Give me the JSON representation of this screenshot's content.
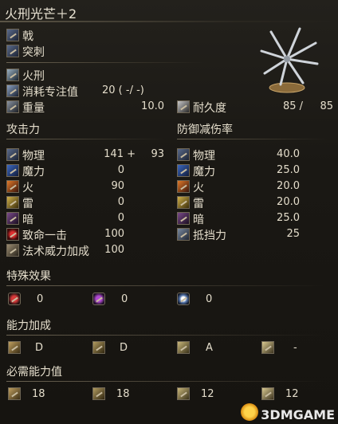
{
  "title": "火刑光芒＋2",
  "weapon_info": {
    "type": "戟",
    "attack_type": "突刺",
    "skill": "火刑",
    "fp_cost_label": "消耗专注值",
    "fp_cost_value": "20 (   -/   -)",
    "weight_label": "重量",
    "weight_value": "10.0",
    "durability_label": "耐久度",
    "durability_current": "85 /",
    "durability_max": "85"
  },
  "attack": {
    "heading": "攻击力",
    "rows": [
      {
        "label": "物理",
        "value": "141 +",
        "bonus": "93"
      },
      {
        "label": "魔力",
        "value": "0",
        "bonus": ""
      },
      {
        "label": "火",
        "value": "90",
        "bonus": ""
      },
      {
        "label": "雷",
        "value": "0",
        "bonus": ""
      },
      {
        "label": "暗",
        "value": "0",
        "bonus": ""
      },
      {
        "label": "致命一击",
        "value": "100",
        "bonus": ""
      },
      {
        "label": "法术威力加成",
        "value": "100",
        "bonus": ""
      }
    ]
  },
  "defense": {
    "heading": "防御减伤率",
    "rows": [
      {
        "label": "物理",
        "value": "40.0"
      },
      {
        "label": "魔力",
        "value": "25.0"
      },
      {
        "label": "火",
        "value": "20.0"
      },
      {
        "label": "雷",
        "value": "20.0"
      },
      {
        "label": "暗",
        "value": "25.0"
      },
      {
        "label": "抵挡力",
        "value": "25"
      }
    ]
  },
  "special": {
    "heading": "特殊效果",
    "items": [
      {
        "icon": "bleed-icon",
        "value": "0"
      },
      {
        "icon": "poison-icon",
        "value": "0"
      },
      {
        "icon": "frost-icon",
        "value": "0"
      }
    ]
  },
  "scaling": {
    "heading": "能力加成",
    "items": [
      {
        "icon": "strength-icon",
        "value": "D"
      },
      {
        "icon": "dexterity-icon",
        "value": "D"
      },
      {
        "icon": "intelligence-icon",
        "value": "A"
      },
      {
        "icon": "faith-icon",
        "value": "-"
      }
    ]
  },
  "requirements": {
    "heading": "必需能力值",
    "items": [
      {
        "icon": "strength-icon",
        "value": "18"
      },
      {
        "icon": "dexterity-icon",
        "value": "18"
      },
      {
        "icon": "intelligence-icon",
        "value": "12"
      },
      {
        "icon": "faith-icon",
        "value": "12"
      }
    ]
  },
  "watermark": "3DMGAME"
}
